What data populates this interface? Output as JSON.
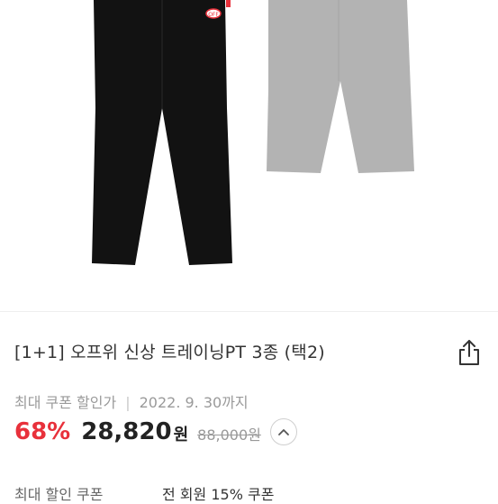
{
  "product": {
    "title": "[1+1] 오프위 신상 트레이닝PT 3종 (택2)",
    "image_alt": "black and grey training pants",
    "patch_text": "OFF"
  },
  "coupon_info": {
    "label": "최대 쿠폰 할인가",
    "separator": "|",
    "deadline": "2022. 9. 30까지"
  },
  "price": {
    "discount": "68%",
    "sale_price": "28,820",
    "currency": "원",
    "original_price": "88,000원"
  },
  "max_coupon": {
    "label": "최대 할인 쿠폰",
    "value": "전 회원 15% 쿠폰"
  },
  "icons": {
    "share": "share-icon",
    "expand": "chevron-up-icon"
  },
  "colors": {
    "discount": "#e8313b",
    "black_pants": "#121212",
    "grey_pants": "#b3b3b3"
  }
}
